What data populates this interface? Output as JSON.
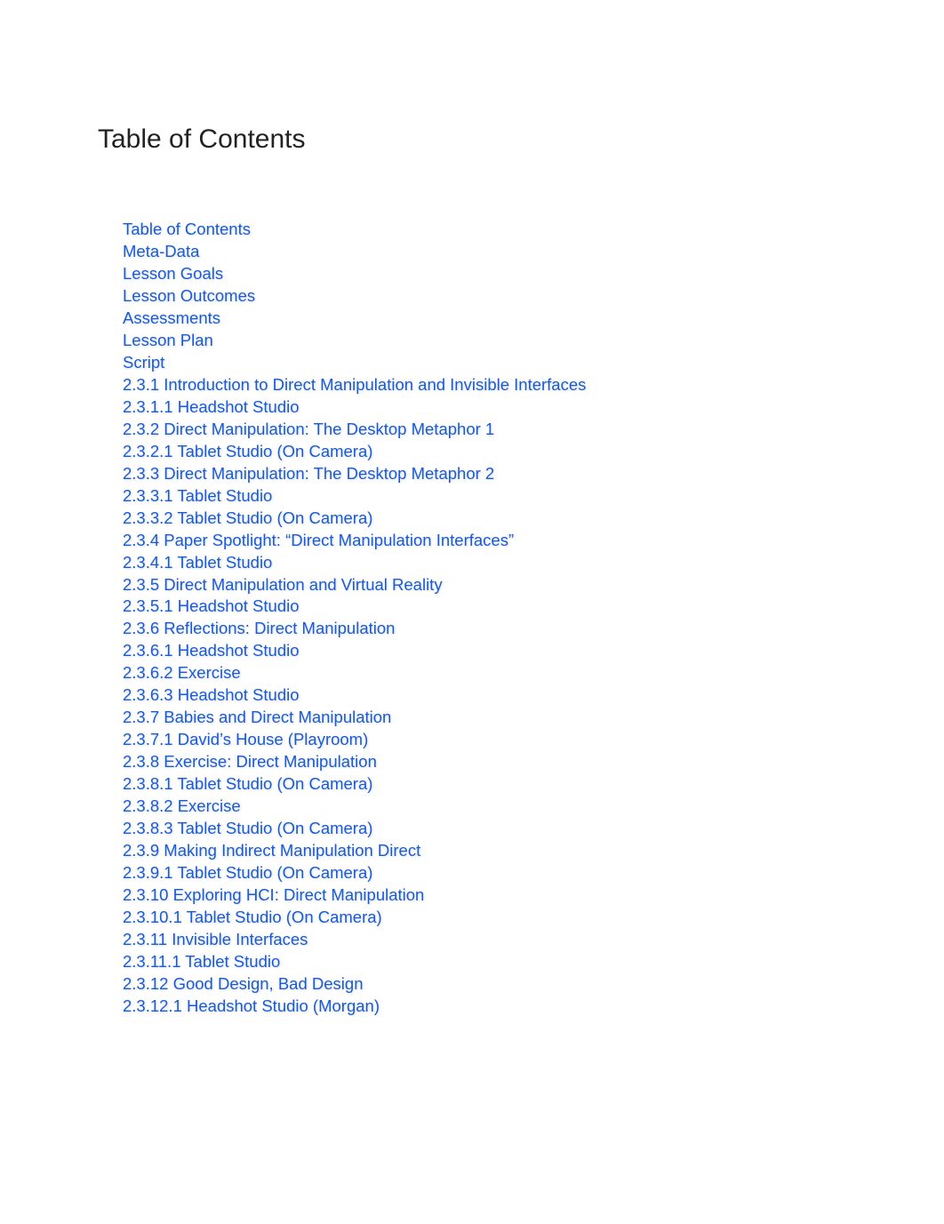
{
  "heading": "Table of Contents",
  "toc": [
    {
      "level": 0,
      "text": "Table of Contents"
    },
    {
      "level": 0,
      "text": "Meta-Data"
    },
    {
      "level": 1,
      "text": "Lesson Goals"
    },
    {
      "level": 1,
      "text": "Lesson Outcomes"
    },
    {
      "level": 1,
      "text": "Assessments"
    },
    {
      "level": 1,
      "text": "Lesson Plan"
    },
    {
      "level": 0,
      "text": "Script"
    },
    {
      "level": 1,
      "text": "2.3.1 Introduction to Direct Manipulation and Invisible Interfaces"
    },
    {
      "level": 2,
      "text": "2.3.1.1 Headshot Studio"
    },
    {
      "level": 1,
      "text": "2.3.2 Direct Manipulation: The Desktop Metaphor 1"
    },
    {
      "level": 2,
      "text": "2.3.2.1 Tablet Studio (On Camera)"
    },
    {
      "level": 1,
      "text": "2.3.3 Direct Manipulation: The Desktop Metaphor 2"
    },
    {
      "level": 2,
      "text": "2.3.3.1 Tablet Studio"
    },
    {
      "level": 2,
      "text": "2.3.3.2 Tablet Studio (On Camera)"
    },
    {
      "level": 1,
      "text": "2.3.4 Paper Spotlight: “Direct Manipulation Interfaces”"
    },
    {
      "level": 2,
      "text": "2.3.4.1 Tablet Studio"
    },
    {
      "level": 1,
      "text": "2.3.5 Direct Manipulation and Virtual Reality"
    },
    {
      "level": 2,
      "text": "2.3.5.1 Headshot Studio"
    },
    {
      "level": 1,
      "text": "2.3.6 Reflections: Direct Manipulation"
    },
    {
      "level": 2,
      "text": "2.3.6.1 Headshot Studio"
    },
    {
      "level": 2,
      "text": "2.3.6.2 Exercise"
    },
    {
      "level": 2,
      "text": "2.3.6.3 Headshot Studio"
    },
    {
      "level": 1,
      "text": "2.3.7 Babies and Direct Manipulation"
    },
    {
      "level": 2,
      "text": "2.3.7.1 David’s House (Playroom)"
    },
    {
      "level": 1,
      "text": "2.3.8 Exercise: Direct Manipulation"
    },
    {
      "level": 2,
      "text": "2.3.8.1 Tablet Studio (On Camera)"
    },
    {
      "level": 2,
      "text": "2.3.8.2 Exercise"
    },
    {
      "level": 2,
      "text": "2.3.8.3 Tablet Studio (On Camera)"
    },
    {
      "level": 1,
      "text": "2.3.9 Making Indirect Manipulation Direct"
    },
    {
      "level": 2,
      "text": "2.3.9.1 Tablet Studio (On Camera)"
    },
    {
      "level": 1,
      "text": "2.3.10 Exploring HCI: Direct Manipulation"
    },
    {
      "level": 2,
      "text": "2.3.10.1 Tablet Studio (On Camera)"
    },
    {
      "level": 1,
      "text": "2.3.11 Invisible Interfaces"
    },
    {
      "level": 2,
      "text": "2.3.11.1 Tablet Studio"
    },
    {
      "level": 1,
      "text": "2.3.12 Good Design, Bad Design"
    },
    {
      "level": 2,
      "text": "2.3.12.1 Headshot Studio (Morgan)"
    }
  ]
}
